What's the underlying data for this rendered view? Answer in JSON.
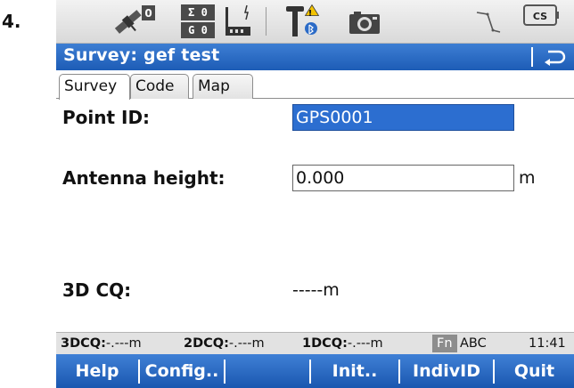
{
  "step_number": "4.",
  "statusbar": {
    "icons": [
      "satellite-icon",
      "sigma-gps-count-icon",
      "base-radio-icon",
      "rover-bluetooth-icon",
      "camera-icon",
      "line-survey-icon",
      "cs-controller-icon"
    ],
    "sigma_row1": "Σ 0",
    "sigma_row2": "G 0",
    "sat_count": "0",
    "cs_label": "CS"
  },
  "titlebar": {
    "title": "Survey: gef test"
  },
  "tabs": [
    {
      "label": "Survey",
      "active": true
    },
    {
      "label": "Code",
      "active": false
    },
    {
      "label": "Map",
      "active": false
    }
  ],
  "form": {
    "point_id_label": "Point ID:",
    "point_id_value": "GPS0001",
    "antenna_label": "Antenna height:",
    "antenna_value": "0.000",
    "antenna_unit": "m",
    "cq_label": "3D CQ:",
    "cq_value": "-----m"
  },
  "infobar": {
    "cq3d_label": "3DCQ:",
    "cq3d_value": "-.---m",
    "cq2d_label": "2DCQ:",
    "cq2d_value": "-.---m",
    "cq1d_label": "1DCQ:",
    "cq1d_value": "-.---m",
    "fn_label": "Fn",
    "input_mode": "ABC",
    "time": "11:41"
  },
  "softkeys": {
    "help": "Help",
    "config": "Config..",
    "init": "Init..",
    "indivId": "IndivID",
    "quit": "Quit"
  },
  "colors": {
    "accent_blue": "#1d5cb6",
    "selection_blue": "#2c6ed0",
    "warning_yellow": "#f2c200"
  }
}
